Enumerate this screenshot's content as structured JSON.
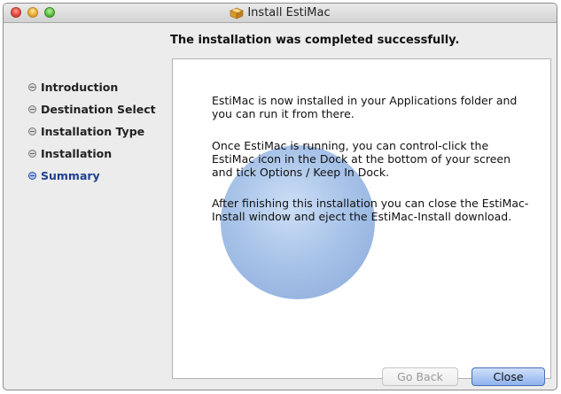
{
  "window": {
    "title": "Install EstiMac"
  },
  "header": {
    "text": "The installation was completed successfully."
  },
  "sidebar": {
    "steps": [
      {
        "label": "Introduction",
        "current": false
      },
      {
        "label": "Destination Select",
        "current": false
      },
      {
        "label": "Installation Type",
        "current": false
      },
      {
        "label": "Installation",
        "current": false
      },
      {
        "label": "Summary",
        "current": true
      }
    ]
  },
  "content": {
    "paragraphs": [
      "EstiMac is now installed in your Applications folder and you can run it from there.",
      "Once EstiMac is running, you can control-click the EstiMac icon in the Dock at the bottom of your screen and tick Options / Keep In Dock.",
      "After finishing this installation you can close the EstiMac-Install window and eject the EstiMac-Install download."
    ]
  },
  "buttons": {
    "go_back": "Go Back",
    "close": "Close"
  },
  "icons": {
    "window_icon": "package-icon"
  },
  "colors": {
    "current_step": "#1f3f8f",
    "default_button": "#8fb2ec"
  }
}
